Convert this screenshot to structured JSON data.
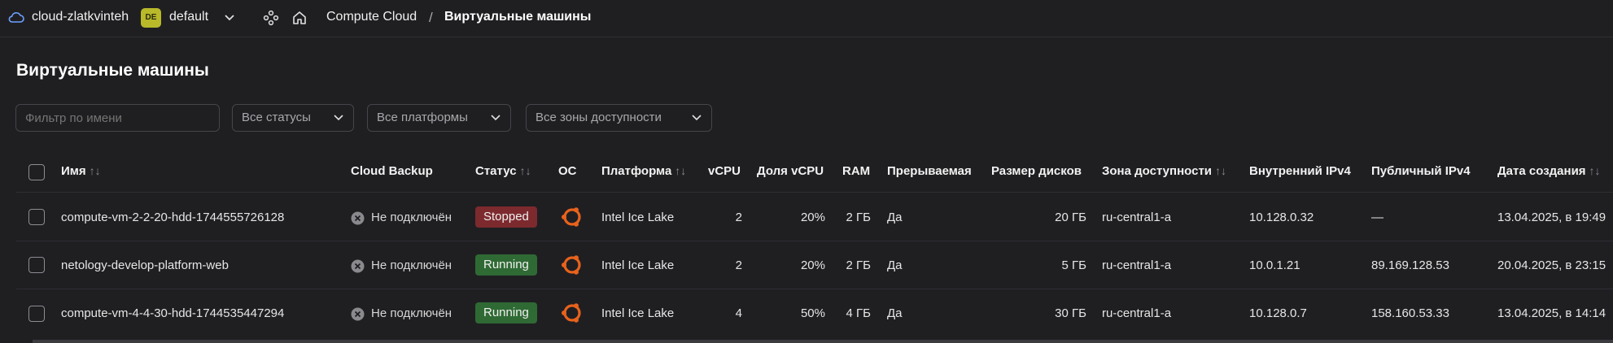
{
  "topbar": {
    "cloud_name": "cloud-zlatkvinteh",
    "folder_badge": "DE",
    "folder_badge_color": "#b9b92a",
    "folder_name": "default",
    "breadcrumb_service": "Compute Cloud",
    "breadcrumb_separator": "/",
    "breadcrumb_current": "Виртуальные машины"
  },
  "page": {
    "title": "Виртуальные машины"
  },
  "filters": {
    "name_placeholder": "Фильтр по имени",
    "status": "Все статусы",
    "platform": "Все платформы",
    "zone": "Все зоны доступности"
  },
  "table": {
    "columns": {
      "name": "Имя",
      "backup": "Cloud Backup",
      "status": "Статус",
      "os": "ОС",
      "platform": "Платформа",
      "vcpu": "vCPU",
      "vcpu_share": "Доля vCPU",
      "ram": "RAM",
      "preemptible": "Прерываемая",
      "disk_size": "Размер дисков",
      "zone": "Зона доступности",
      "internal_ip": "Внутренний IPv4",
      "public_ip": "Публичный IPv4",
      "created": "Дата создания"
    },
    "sort_glyph": "↑↓",
    "rows": [
      {
        "name": "compute-vm-2-2-20-hdd-1744555726128",
        "backup": "Не подключён",
        "status": "Stopped",
        "status_color": "#7d2a2e",
        "os": "ubuntu-icon",
        "platform": "Intel Ice Lake",
        "vcpu": "2",
        "vcpu_share": "20%",
        "ram": "2 ГБ",
        "preemptible": "Да",
        "disk_size": "20 ГБ",
        "zone": "ru-central1-a",
        "internal_ip": "10.128.0.32",
        "public_ip": "—",
        "created": "13.04.2025, в 19:49"
      },
      {
        "name": "netology-develop-platform-web",
        "backup": "Не подключён",
        "status": "Running",
        "status_color": "#2f6a34",
        "os": "ubuntu-icon",
        "platform": "Intel Ice Lake",
        "vcpu": "2",
        "vcpu_share": "20%",
        "ram": "2 ГБ",
        "preemptible": "Да",
        "disk_size": "5 ГБ",
        "zone": "ru-central1-a",
        "internal_ip": "10.0.1.21",
        "public_ip": "89.169.128.53",
        "created": "20.04.2025, в 23:15"
      },
      {
        "name": "compute-vm-4-4-30-hdd-1744535447294",
        "backup": "Не подключён",
        "status": "Running",
        "status_color": "#2f6a34",
        "os": "ubuntu-icon",
        "platform": "Intel Ice Lake",
        "vcpu": "4",
        "vcpu_share": "50%",
        "ram": "4 ГБ",
        "preemptible": "Да",
        "disk_size": "30 ГБ",
        "zone": "ru-central1-a",
        "internal_ip": "10.128.0.7",
        "public_ip": "158.160.53.33",
        "created": "13.04.2025, в 14:14"
      }
    ]
  },
  "colors": {
    "background": "#1f1f22",
    "ubuntu_orange": "#e8621c"
  }
}
